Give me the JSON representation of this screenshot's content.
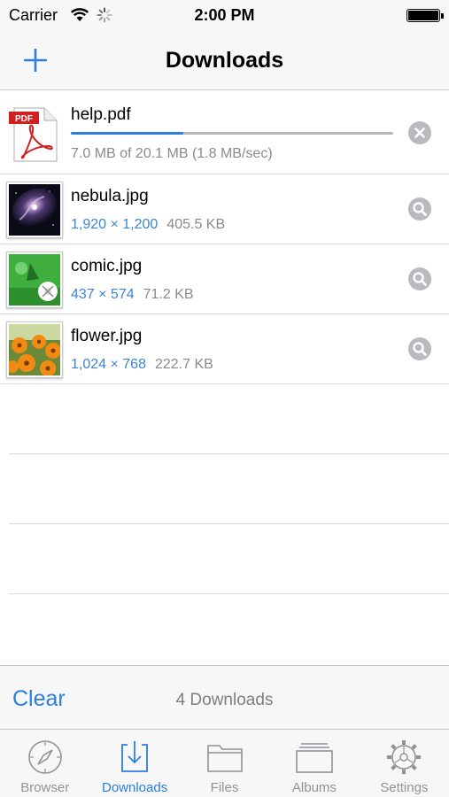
{
  "status_bar": {
    "carrier": "Carrier",
    "time": "2:00 PM"
  },
  "nav": {
    "title": "Downloads"
  },
  "downloads": [
    {
      "name": "help.pdf",
      "type": "pdf",
      "progress_text": "7.0 MB of 20.1 MB (1.8 MB/sec)",
      "progress": 0.35,
      "action": "cancel-icon"
    },
    {
      "name": "nebula.jpg",
      "type": "image",
      "dimensions": "1,920 × 1,200",
      "size": "405.5 KB",
      "action": "search-icon"
    },
    {
      "name": "comic.jpg",
      "type": "image",
      "dimensions": "437 × 574",
      "size": "71.2 KB",
      "action": "search-icon"
    },
    {
      "name": "flower.jpg",
      "type": "image",
      "dimensions": "1,024 × 768",
      "size": "222.7 KB",
      "action": "search-icon"
    }
  ],
  "toolbar": {
    "clear_label": "Clear",
    "count_label": "4 Downloads"
  },
  "tabs": [
    {
      "label": "Browser",
      "icon": "compass-icon",
      "active": false
    },
    {
      "label": "Downloads",
      "icon": "download-icon",
      "active": true
    },
    {
      "label": "Files",
      "icon": "folder-icon",
      "active": false
    },
    {
      "label": "Albums",
      "icon": "albums-icon",
      "active": false
    },
    {
      "label": "Settings",
      "icon": "gear-icon",
      "active": false
    }
  ],
  "colors": {
    "accent": "#2c7ee3",
    "secondary_text": "#8a8a8f",
    "dimension_text": "#3b85d6",
    "bar_background": "#f7f7f7"
  }
}
